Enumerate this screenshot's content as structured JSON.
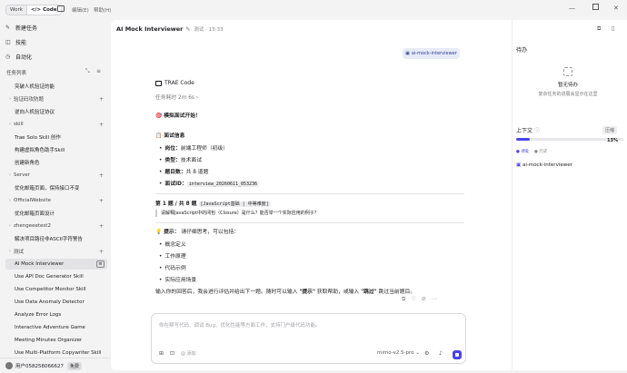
{
  "topbar": {
    "mode_work": "Work",
    "mode_code": "Code",
    "menu_edit": "编辑(E)",
    "menu_help": "帮助(H)"
  },
  "sidebar": {
    "nav": [
      {
        "label": "新建任务",
        "icon": "new-task-icon"
      },
      {
        "label": "技能",
        "icon": "skill-icon"
      },
      {
        "label": "自动化",
        "icon": "automation-icon"
      }
    ],
    "tasks_title": "任务列表",
    "rows": [
      {
        "label": "突破人机验证的能",
        "type": "item"
      },
      {
        "label": "验证码攻防题",
        "type": "group"
      },
      {
        "label": "逆向人机验证协议",
        "type": "item"
      },
      {
        "label": "skill",
        "type": "group"
      },
      {
        "label": "Trae Solo Skill 创作",
        "type": "item"
      },
      {
        "label": "构建虚拟角色助手Skill",
        "type": "item"
      },
      {
        "label": "创建新角色",
        "type": "item"
      },
      {
        "label": "Server",
        "type": "group"
      },
      {
        "label": "优化邮箱页面，保持接口不变",
        "type": "item"
      },
      {
        "label": "OfficialWebsite",
        "type": "group"
      },
      {
        "label": "优化邮箱页面设计",
        "type": "item"
      },
      {
        "label": "zhengeeetest2",
        "type": "group"
      },
      {
        "label": "解决项目路径非ASCII字符警告",
        "type": "item"
      },
      {
        "label": "测试",
        "type": "group"
      },
      {
        "label": "AI Mock Interviewer",
        "type": "active"
      },
      {
        "label": "Use API Doc Generator Skill",
        "type": "item"
      },
      {
        "label": "Use Competitor Monitor Skill",
        "type": "item"
      },
      {
        "label": "Use Data Anomaly Detector",
        "type": "item"
      },
      {
        "label": "Analyze Error Logs",
        "type": "item"
      },
      {
        "label": "Interactive Adventure Game",
        "type": "item"
      },
      {
        "label": "Meeting Minutes Organizer",
        "type": "item"
      },
      {
        "label": "Use Multi-Platform Copywriter Skill",
        "type": "item"
      }
    ],
    "user_name": "用户058258066627",
    "plan_badge": "免费"
  },
  "main": {
    "title": "AI Mock Interviewer",
    "breadcrumb": "测试 · 13:33",
    "chip": "ai-mock-interviewer",
    "agent_name": "TRAE Code",
    "elapsed": "任务耗时 2m 6s",
    "heading": "🎯 模拟面试开始！",
    "info_title": "📋 面试信息",
    "info": [
      {
        "label": "岗位：",
        "value": "前端工程师（初级）"
      },
      {
        "label": "类型：",
        "value": "技术面试"
      },
      {
        "label": "题目数：",
        "value": "共 8 道题"
      },
      {
        "label": "面试ID：",
        "value": "interview_20260611_053236"
      }
    ],
    "q_title_prefix": "第 1 题 / 共 8 题",
    "q_tag": "[JavaScript基础 | 中等难度]",
    "q_text": "请解释JavaScript中的闭包（Closure）是什么？能否举一个实际应用的例子？",
    "tip_label": "提示：",
    "tip_text": "请仔细思考，可以包括：",
    "tips": [
      "概念定义",
      "工作原理",
      "代码示例",
      "实际应用场景"
    ],
    "footer_pre": "输入你的回答后，我会进行评估并给出下一题。随时可以输入 ",
    "footer_hint": "\"提示\"",
    "footer_mid": " 获取帮助，或输入 ",
    "footer_skip": "\"跳过\"",
    "footer_post": " 跳过当前题目。"
  },
  "composer": {
    "placeholder": "你在帮写代码、调试 Bug、优化性能等方面工作，支持门户级代码功能。",
    "model": "mimo-v2.5-pro",
    "add_label": "添加"
  },
  "right": {
    "todo_title": "待办",
    "empty_title": "暂无待办",
    "empty_desc": "复杂任务的进展会显示在这里",
    "context_title": "上下文",
    "compress_label": "压缩",
    "progress_pct": 13,
    "progress_text": "13%",
    "tab_a": "● 待处",
    "tab_b": "● 历史",
    "file_label": "ai-mock-interviewer"
  }
}
